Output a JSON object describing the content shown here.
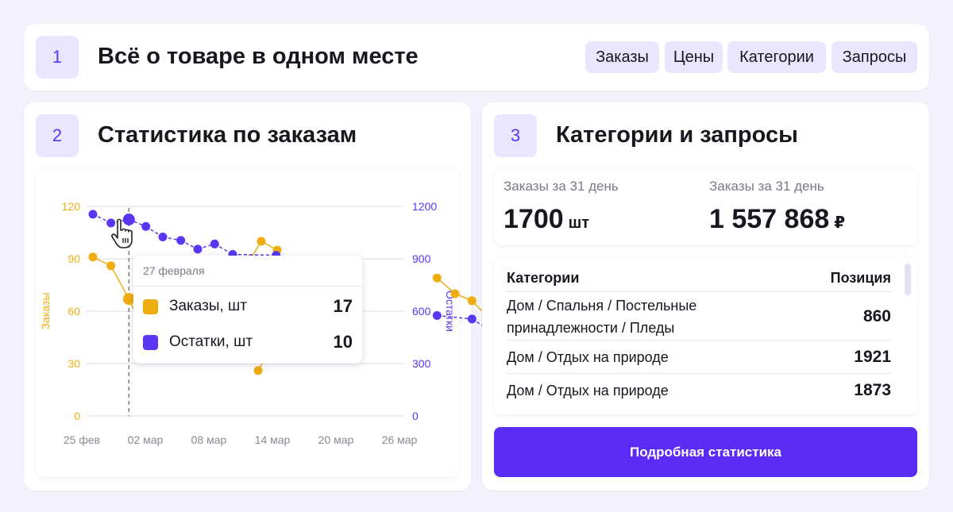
{
  "header": {
    "badge": "1",
    "title": "Всё о товаре в одном месте",
    "tags": [
      "Заказы",
      "Цены",
      "Категории",
      "Запросы"
    ]
  },
  "stats_card": {
    "badge": "2",
    "title": "Статистика по заказам"
  },
  "categories_card": {
    "badge": "3",
    "title": "Категории и запросы",
    "orders_count_caption": "Заказы за 31 день",
    "orders_count_value": "1700",
    "orders_count_unit": "шт",
    "orders_sum_caption": "Заказы за 31 день",
    "orders_sum_value": "1 557 868",
    "orders_sum_unit": "₽",
    "table": {
      "col_category": "Категории",
      "col_position": "Позиция",
      "rows": [
        {
          "category": "Дом / Спальня / Постельные принадлежности / Пледы",
          "position": "860"
        },
        {
          "category": "Дом / Отдых на природе",
          "position": "1921"
        },
        {
          "category": "Дом / Отдых на природе",
          "position": "1873"
        }
      ]
    },
    "cta_label": "Подробная статистика"
  },
  "tooltip": {
    "date": "27 февраля",
    "orders_label": "Заказы, шт",
    "orders_value": "17",
    "stock_label": "Остатки, шт",
    "stock_value": "10"
  },
  "colors": {
    "accent": "#5b2cf5",
    "orders": "#f0ad0f",
    "stock": "#5b36f2",
    "badge_bg": "#e9e6fd"
  },
  "chart_data": {
    "type": "line",
    "x_ticks": [
      "25 фев",
      "02 мар",
      "08 мар",
      "14 мар",
      "20 мар",
      "26 мар"
    ],
    "y_left": {
      "label": "Заказы",
      "ticks": [
        0,
        30,
        60,
        90,
        120
      ],
      "range": [
        0,
        120
      ]
    },
    "y_right": {
      "label": "Остатки",
      "ticks": [
        0,
        300,
        600,
        900,
        1200
      ],
      "range": [
        0,
        1200
      ]
    },
    "series": [
      {
        "name": "Заказы",
        "axis": "left",
        "points": [
          [
            0.6,
            91
          ],
          [
            2.3,
            86
          ],
          [
            4.0,
            67
          ],
          [
            5.6,
            46
          ],
          [
            16.2,
            26
          ],
          [
            17.9,
            44
          ],
          [
            15.5,
            90
          ],
          [
            16.5,
            100
          ],
          [
            18.0,
            95
          ],
          [
            33.1,
            79
          ],
          [
            34.8,
            70
          ],
          [
            36.4,
            66
          ],
          [
            38.0,
            56
          ]
        ]
      },
      {
        "name": "Остатки",
        "axis": "right",
        "points": [
          [
            0.6,
            1155
          ],
          [
            2.3,
            1105
          ],
          [
            4.0,
            1125
          ],
          [
            5.6,
            1085
          ],
          [
            7.2,
            1025
          ],
          [
            8.9,
            1005
          ],
          [
            10.5,
            955
          ],
          [
            12.1,
            985
          ],
          [
            13.8,
            925
          ],
          [
            17.9,
            920
          ],
          [
            33.1,
            575
          ],
          [
            36.4,
            555
          ],
          [
            38.0,
            495
          ]
        ]
      }
    ],
    "highlight_x": 4.0
  }
}
